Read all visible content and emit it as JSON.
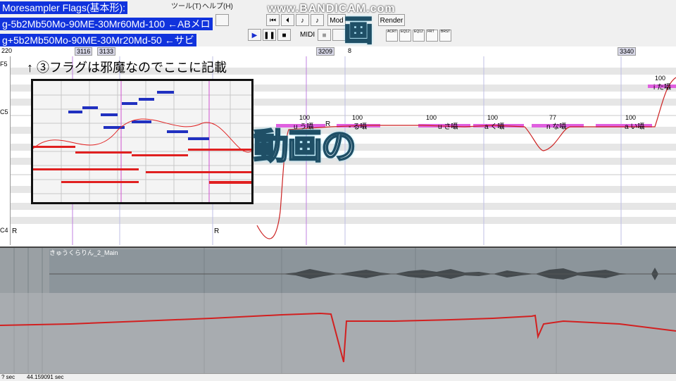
{
  "menubar": {
    "items": [
      "ツール(T)",
      "ヘルプ(H)"
    ]
  },
  "toolbar": {
    "mode_label": "Mod",
    "render_label": "Render",
    "midi_label": "MIDI",
    "effect_labels": [
      "ACRT",
      "EQ12",
      "EQ12",
      "FRT",
      "BRST"
    ]
  },
  "overlay": {
    "flags_title": "Moresampler Flags(基本形):",
    "flags_line_1": "g-5b2Mb50Mo-90ME-30Mr60Md-100 ←ABメロ",
    "flags_line_2": "g+5b2Mb50Mo-90ME-30Mr20Md-50 ←サビ",
    "watermark": "www.BANDICAM.com",
    "big_char_1": "画",
    "big_char_2": "動画の",
    "annotation": "↑ ③フラグは邪魔なのでここに記載"
  },
  "ruler": {
    "marks": [
      "3116",
      "3133",
      "3209",
      "3340"
    ],
    "inline_digits": [
      "8",
      "8"
    ],
    "left_label": "220"
  },
  "keys": {
    "f5": "F5",
    "c5": "C5",
    "c4": "C4"
  },
  "notes": [
    {
      "lyric": "u う囁",
      "intensity": "100"
    },
    {
      "lyric": "R",
      "intensity": ""
    },
    {
      "lyric": "- る囁",
      "intensity": "100"
    },
    {
      "lyric": "u さ囁",
      "intensity": "100"
    },
    {
      "lyric": "a く囁",
      "intensity": "100"
    },
    {
      "lyric": "n な囁",
      "intensity": "77"
    },
    {
      "lyric": "a い囁",
      "intensity": "100"
    },
    {
      "lyric": "i た囁",
      "intensity": "100"
    }
  ],
  "rests": [
    "R",
    "R"
  ],
  "track": {
    "title": "きゅうくらりん_2_Main"
  },
  "status": {
    "left": "? sec",
    "time": "44.159091 sec"
  },
  "colors": {
    "flag_overlay_bg": "#1133dd",
    "pitch_line": "#cc2222",
    "note_bar": "#e060e0"
  }
}
